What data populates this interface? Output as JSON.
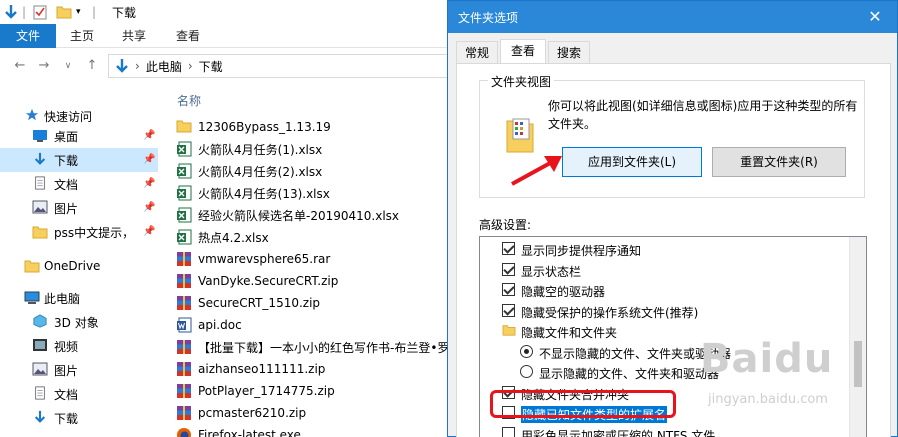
{
  "explorer": {
    "title": "下载",
    "ribbon_tabs": [
      "文件",
      "主页",
      "共享",
      "查看"
    ],
    "breadcrumb": [
      "此电脑",
      "下载"
    ],
    "nav": [
      {
        "label": "快速访问",
        "icon": "star-icon"
      },
      {
        "label": "桌面",
        "icon": "desktop-icon",
        "pinned": true
      },
      {
        "label": "下载",
        "icon": "download-icon",
        "pinned": true,
        "selected": true
      },
      {
        "label": "文档",
        "icon": "document-icon",
        "pinned": true
      },
      {
        "label": "图片",
        "icon": "picture-icon",
        "pinned": true
      },
      {
        "label": "pss中文提示，",
        "icon": "folder-icon",
        "pinned": true
      },
      {
        "label": "OneDrive",
        "icon": "folder-icon"
      },
      {
        "label": "此电脑",
        "icon": "computer-icon"
      },
      {
        "label": "3D 对象",
        "icon": "cube-icon"
      },
      {
        "label": "视频",
        "icon": "video-icon"
      },
      {
        "label": "图片",
        "icon": "picture-icon"
      },
      {
        "label": "文档",
        "icon": "document-icon"
      },
      {
        "label": "下载",
        "icon": "download-icon"
      }
    ],
    "column_name": "名称",
    "files": [
      {
        "name": "12306Bypass_1.13.19",
        "icon": "folder-icon"
      },
      {
        "name": "火箭队4月任务(1).xlsx",
        "icon": "excel-icon"
      },
      {
        "name": "火箭队4月任务(2).xlsx",
        "icon": "excel-icon"
      },
      {
        "name": "火箭队4月任务(13).xlsx",
        "icon": "excel-icon"
      },
      {
        "name": "经验火箭队候选名单-20190410.xlsx",
        "icon": "excel-icon"
      },
      {
        "name": "热点4.2.xlsx",
        "icon": "excel-icon"
      },
      {
        "name": "vmwarevsphere65.rar",
        "icon": "archive-icon"
      },
      {
        "name": "VanDyke.SecureCRT.zip",
        "icon": "archive-icon"
      },
      {
        "name": "SecureCRT_1510.zip",
        "icon": "archive-icon"
      },
      {
        "name": "api.doc",
        "icon": "word-icon"
      },
      {
        "name": "【批量下载】一本小小的红色写作书-布兰登•罗",
        "icon": "archive-icon"
      },
      {
        "name": "aizhanseo111111.zip",
        "icon": "archive-icon"
      },
      {
        "name": "PotPlayer_1714775.zip",
        "icon": "archive-icon"
      },
      {
        "name": "pcmaster6210.zip",
        "icon": "archive-icon"
      },
      {
        "name": "Firefox-latest.exe",
        "icon": "firefox-icon"
      }
    ]
  },
  "dialog": {
    "title": "文件夹选项",
    "tabs": [
      "常规",
      "查看",
      "搜索"
    ],
    "active_tab": "查看",
    "folder_views_legend": "文件夹视图",
    "folder_views_desc": "你可以将此视图(如详细信息或图标)应用于这种类型的所有文件夹。",
    "apply_button": "应用到文件夹(L)",
    "reset_button": "重置文件夹(R)",
    "advanced_label": "高级设置:",
    "advanced": [
      {
        "type": "checkbox",
        "checked": true,
        "label": "显示同步提供程序通知",
        "indent": 0
      },
      {
        "type": "checkbox",
        "checked": true,
        "label": "显示状态栏",
        "indent": 0
      },
      {
        "type": "checkbox",
        "checked": true,
        "label": "隐藏空的驱动器",
        "indent": 0
      },
      {
        "type": "checkbox",
        "checked": true,
        "label": "隐藏受保护的操作系统文件(推荐)",
        "indent": 0
      },
      {
        "type": "folder",
        "label": "隐藏文件和文件夹",
        "indent": 0
      },
      {
        "type": "radio",
        "checked": true,
        "label": "不显示隐藏的文件、文件夹或驱动器",
        "indent": 1
      },
      {
        "type": "radio",
        "checked": false,
        "label": "显示隐藏的文件、文件夹和驱动器",
        "indent": 1
      },
      {
        "type": "checkbox",
        "checked": true,
        "label": "隐藏文件夹合并冲突",
        "indent": 0
      },
      {
        "type": "checkbox",
        "checked": false,
        "label": "隐藏已知文件类型的扩展名",
        "indent": 0,
        "highlight": true
      },
      {
        "type": "checkbox",
        "checked": false,
        "label": "用彩色显示加密或压缩的 NTFS 文件",
        "indent": 0
      }
    ]
  },
  "watermark": {
    "logo": "Baidu",
    "sub": "jingyan.baidu.com"
  },
  "colors": {
    "accent": "#1979ca",
    "dialog_title": "#2b88d8",
    "annotation": "#e8131b",
    "highlight": "#0078d7"
  }
}
